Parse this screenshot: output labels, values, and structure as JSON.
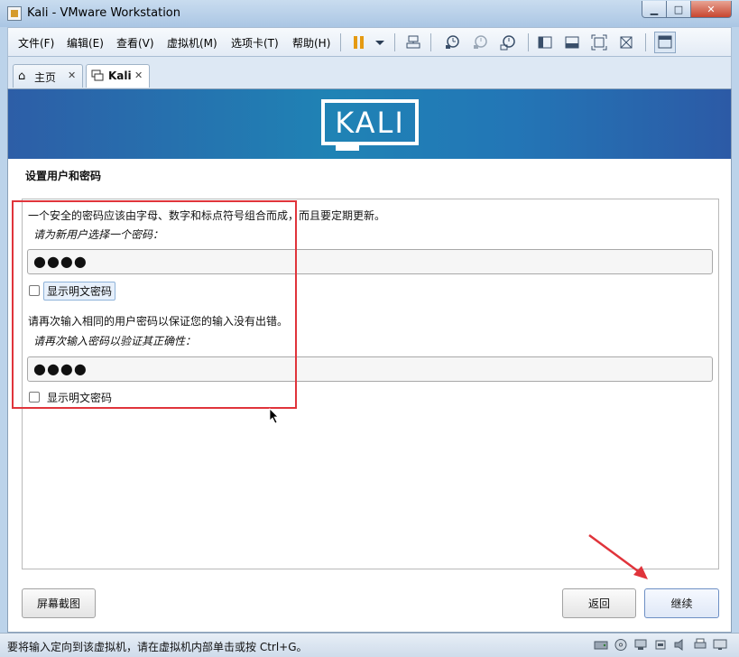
{
  "window": {
    "title": "Kali - VMware Workstation",
    "min_glyph": "▁",
    "max_glyph": "□",
    "close_glyph": "✕"
  },
  "menu": {
    "items": [
      {
        "label": "文件(F)"
      },
      {
        "label": "编辑(E)"
      },
      {
        "label": "查看(V)"
      },
      {
        "label": "虚拟机(M)"
      },
      {
        "label": "选项卡(T)"
      },
      {
        "label": "帮助(H)"
      }
    ]
  },
  "toolbar": {
    "icons": [
      "pause-icon",
      "dropdown-arrow-icon",
      "send-ctrl-alt-del-icon",
      "snapshot-take-icon",
      "snapshot-revert-icon",
      "snapshot-manager-icon",
      "show-library-icon",
      "console-view-icon",
      "full-screen-icon",
      "unity-icon",
      "thumbnail-view-icon"
    ]
  },
  "tabs": [
    {
      "label": "主页",
      "close": "✕"
    },
    {
      "label": "Kali",
      "close": "✕"
    }
  ],
  "vm": {
    "logo_text": "KALI",
    "section_title": "设置用户和密码",
    "instruction_1": "一个安全的密码应该由字母、数字和标点符号组合而成，而且要定期更新。",
    "prompt_1": "请为新用户选择一个密码：",
    "password_1_mask": "●●●●",
    "show_password_1": "显示明文密码",
    "instruction_2": "请再次输入相同的用户密码以保证您的输入没有出错。",
    "prompt_2": "请再次输入密码以验证其正确性：",
    "password_2_mask": "●●●●",
    "show_password_2": "显示明文密码",
    "screenshot_button": "屏幕截图",
    "back_button": "返回",
    "continue_button": "继续"
  },
  "status": {
    "text": "要将输入定向到该虚拟机，请在虚拟机内部单击或按 Ctrl+G。"
  },
  "colors": {
    "banner_start": "#2d5ea7",
    "banner_mid": "#1f83b5",
    "highlight_red": "#e0343b",
    "titlebar": "#b9d0e8"
  }
}
